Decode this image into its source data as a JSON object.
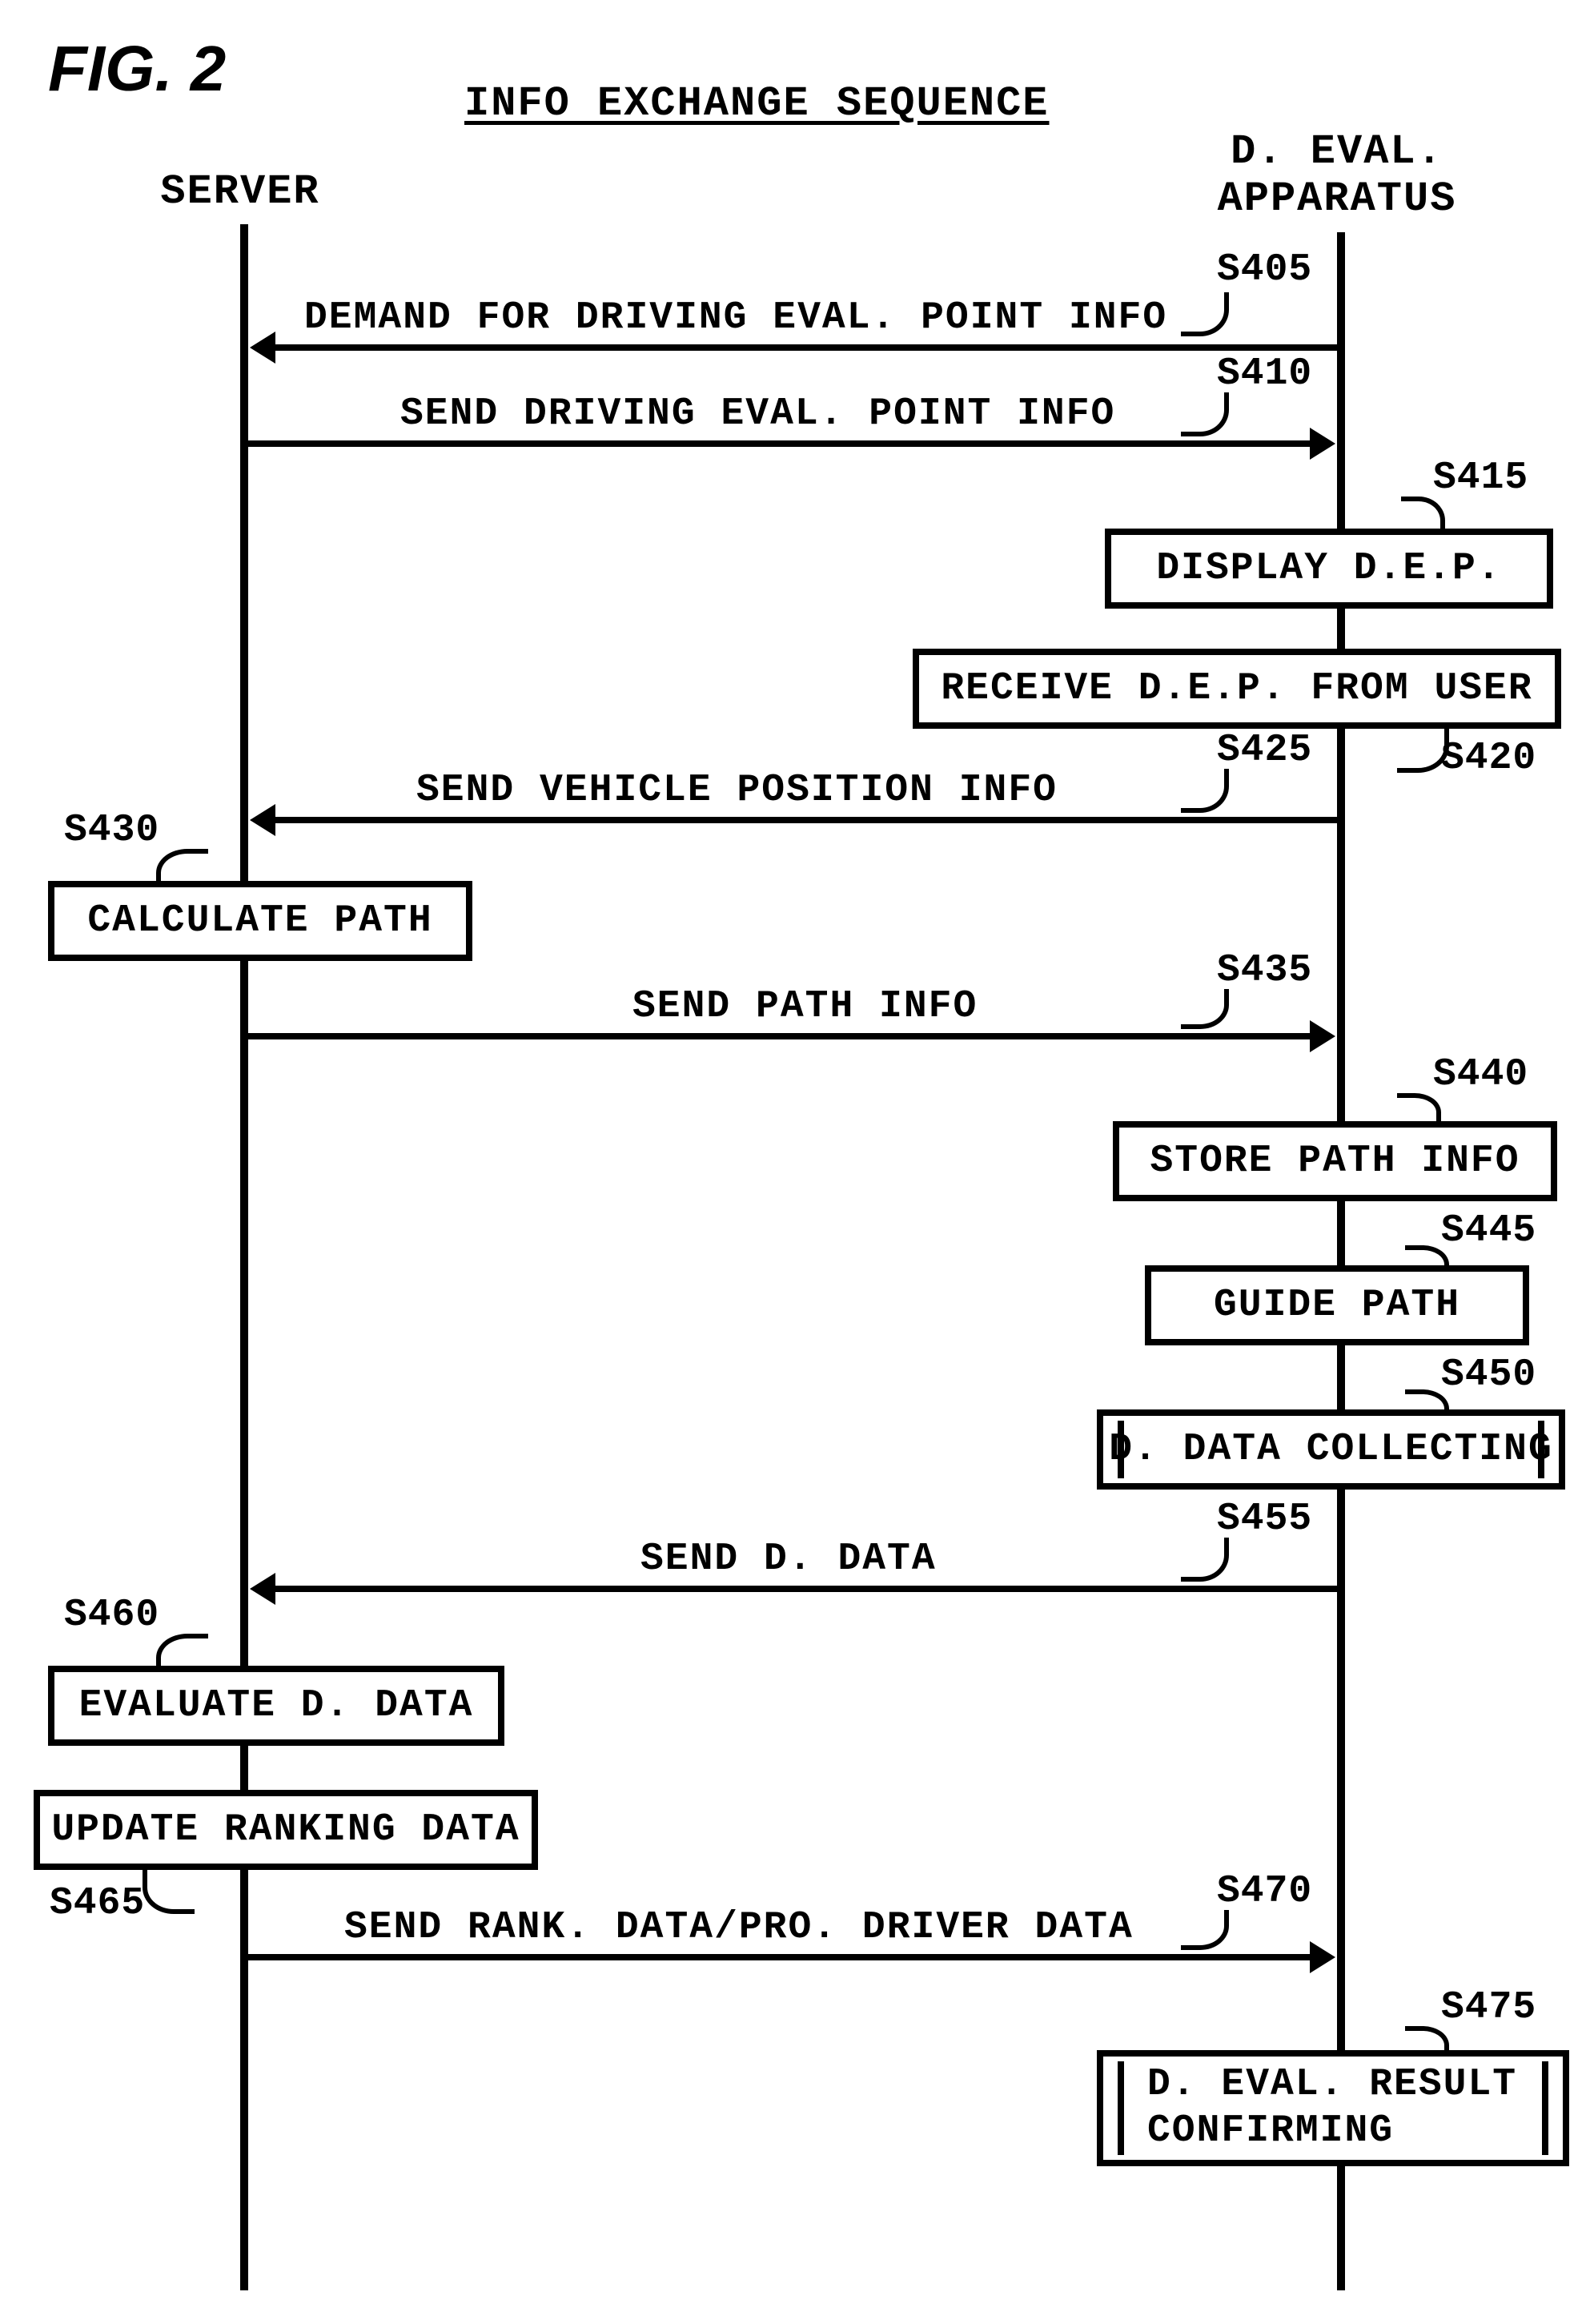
{
  "figure_label": "FIG. 2",
  "title": "INFO EXCHANGE SEQUENCE",
  "lifelines": {
    "server": "SERVER",
    "apparatus": "D.  EVAL.\nAPPARATUS"
  },
  "messages": {
    "s405": {
      "label": "S405",
      "text": "DEMAND FOR DRIVING EVAL. POINT INFO"
    },
    "s410": {
      "label": "S410",
      "text": "SEND DRIVING EVAL. POINT INFO"
    },
    "s425": {
      "label": "S425",
      "text": "SEND VEHICLE POSITION INFO"
    },
    "s435": {
      "label": "S435",
      "text": "SEND PATH INFO"
    },
    "s455": {
      "label": "S455",
      "text": "SEND D. DATA"
    },
    "s470": {
      "label": "S470",
      "text": "SEND RANK. DATA/PRO. DRIVER DATA"
    }
  },
  "boxes": {
    "s415": {
      "label": "S415",
      "text": "DISPLAY D.E.P."
    },
    "s420": {
      "label": "S420",
      "text": "RECEIVE D.E.P. FROM USER"
    },
    "s430": {
      "label": "S430",
      "text": "CALCULATE PATH"
    },
    "s440": {
      "label": "S440",
      "text": "STORE PATH INFO"
    },
    "s445": {
      "label": "S445",
      "text": "GUIDE PATH"
    },
    "s450": {
      "label": "S450",
      "text": "D. DATA COLLECTING"
    },
    "s460": {
      "label": "S460",
      "text": "EVALUATE D. DATA"
    },
    "s465": {
      "label": "S465",
      "text": "UPDATE RANKING DATA"
    },
    "s475": {
      "label": "S475",
      "text": "D. EVAL. RESULT\nCONFIRMING"
    }
  }
}
